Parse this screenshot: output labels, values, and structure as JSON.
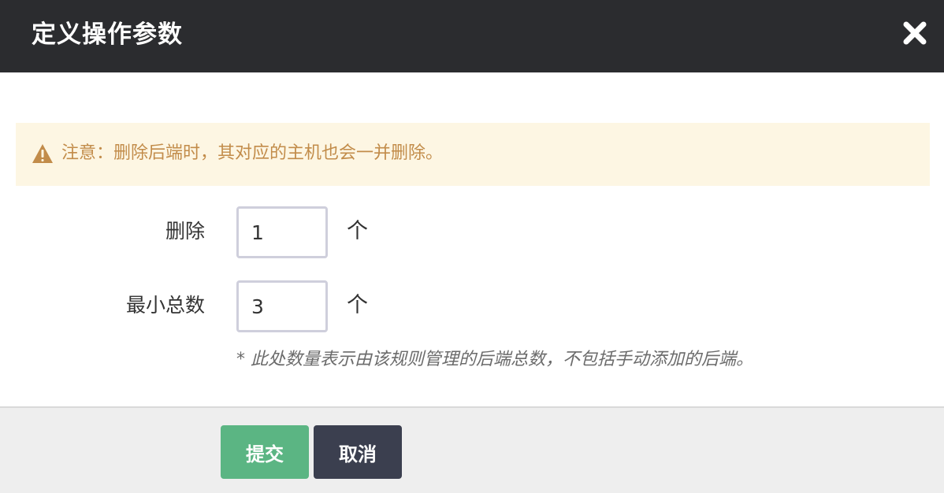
{
  "dialog": {
    "title": "定义操作参数",
    "close_icon": "close-icon"
  },
  "alert": {
    "icon": "warning-icon",
    "text": "注意：删除后端时，其对应的主机也会一并删除。",
    "color": "#c28c4a",
    "background": "#fdf6e3"
  },
  "form": {
    "delete": {
      "label": "删除",
      "value": "1",
      "unit": "个"
    },
    "min_total": {
      "label": "最小总数",
      "value": "3",
      "unit": "个"
    },
    "hint": "* 此处数量表示由该规则管理的后端总数，不包括手动添加的后端。"
  },
  "footer": {
    "submit_label": "提交",
    "cancel_label": "取消",
    "submit_color": "#5bb583",
    "cancel_color": "#3b3f4f"
  },
  "colors": {
    "header_bg": "#2b2c2f"
  }
}
